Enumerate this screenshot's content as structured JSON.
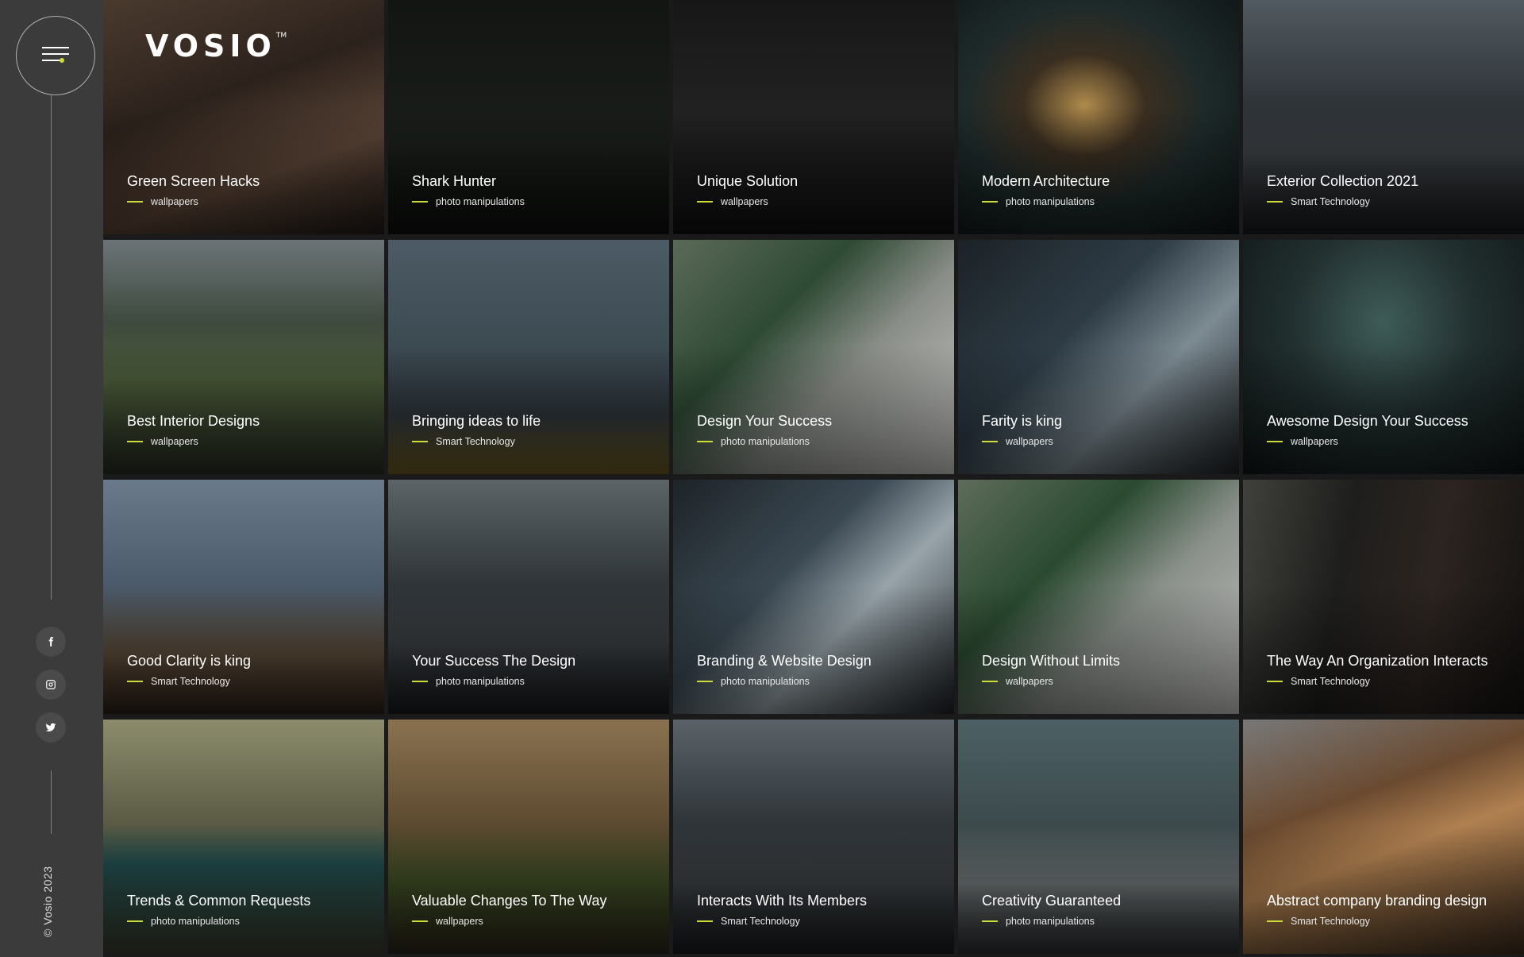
{
  "brand": {
    "name": "VOSIO",
    "trademark": "TM",
    "copyright": "© Vosio 2023"
  },
  "sidebar": {
    "social": [
      {
        "label": "f",
        "icon": "facebook-icon"
      },
      {
        "label": "instagram",
        "icon": "instagram-icon"
      },
      {
        "label": "twitter",
        "icon": "twitter-icon"
      }
    ]
  },
  "colors": {
    "accent": "#cddc39",
    "sidebar_bg": "#3b3b3b"
  },
  "portfolio": [
    {
      "title": "Green Screen Hacks",
      "category": "wallpapers"
    },
    {
      "title": "Shark Hunter",
      "category": "photo manipulations"
    },
    {
      "title": "Unique Solution",
      "category": "wallpapers"
    },
    {
      "title": "Modern Architecture",
      "category": "photo manipulations"
    },
    {
      "title": "Exterior Collection 2021",
      "category": "Smart Technology"
    },
    {
      "title": "Best Interior Designs",
      "category": "wallpapers"
    },
    {
      "title": "Bringing ideas to life",
      "category": "Smart Technology"
    },
    {
      "title": "Design Your Success",
      "category": "photo manipulations"
    },
    {
      "title": "Farity is king",
      "category": "wallpapers"
    },
    {
      "title": "Awesome Design Your Success",
      "category": "wallpapers"
    },
    {
      "title": "Good Clarity is king",
      "category": "Smart Technology"
    },
    {
      "title": "Your Success The Design",
      "category": "photo manipulations"
    },
    {
      "title": "Branding & Website Design",
      "category": "photo manipulations"
    },
    {
      "title": "Design Without Limits",
      "category": "wallpapers"
    },
    {
      "title": "The Way An Organization Interacts",
      "category": "Smart Technology"
    },
    {
      "title": "Trends & Common Requests",
      "category": "photo manipulations"
    },
    {
      "title": "Valuable Changes To The Way",
      "category": "wallpapers"
    },
    {
      "title": "Interacts With Its Members",
      "category": "Smart Technology"
    },
    {
      "title": "Creativity Guaranteed",
      "category": "photo manipulations"
    },
    {
      "title": "Abstract company branding design",
      "category": "Smart Technology"
    }
  ]
}
